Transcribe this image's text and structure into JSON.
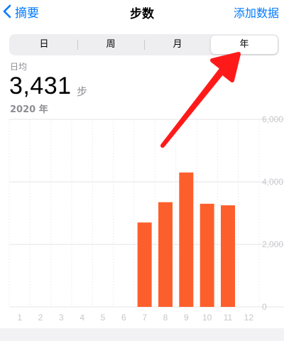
{
  "nav": {
    "back_label": "摘要",
    "title": "步数",
    "action_label": "添加数据"
  },
  "segments": [
    {
      "label": "日",
      "selected": false
    },
    {
      "label": "周",
      "selected": false
    },
    {
      "label": "月",
      "selected": false
    },
    {
      "label": "年",
      "selected": true
    }
  ],
  "summary": {
    "label": "日均",
    "value": "3,431",
    "unit": "步",
    "period": "2020 年"
  },
  "colors": {
    "accent": "#007aff",
    "bar": "#fd5f2c",
    "annotation": "#ff1a1a"
  },
  "chart_data": {
    "type": "bar",
    "categories": [
      "1",
      "2",
      "3",
      "4",
      "5",
      "6",
      "7",
      "8",
      "9",
      "10",
      "11",
      "12"
    ],
    "values": [
      0,
      0,
      0,
      0,
      0,
      0,
      2700,
      3350,
      4300,
      3300,
      3250,
      0
    ],
    "ylim": [
      0,
      6000
    ],
    "yticks": [
      "6,000",
      "4,000",
      "2,000",
      "0"
    ],
    "grid": true
  }
}
